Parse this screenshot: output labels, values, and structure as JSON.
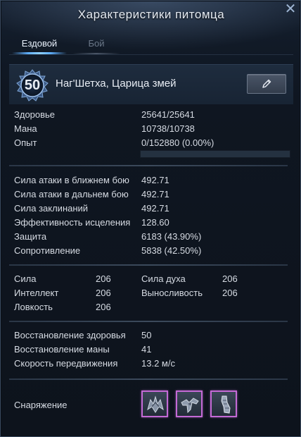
{
  "window": {
    "title": "Характеристики питомца"
  },
  "tabs": [
    {
      "label": "Ездовой",
      "active": true
    },
    {
      "label": "Бой",
      "active": false
    }
  ],
  "pet": {
    "level": "50",
    "name": "Наг'Шетха, Царица змей"
  },
  "basic": {
    "health": {
      "label": "Здоровье",
      "value": "25641/25641"
    },
    "mana": {
      "label": "Мана",
      "value": "10738/10738"
    },
    "exp": {
      "label": "Опыт",
      "value": "0/152880 (0.00%)",
      "progress": 0.0
    }
  },
  "combat": {
    "melee": {
      "label": "Сила атаки в ближнем бою",
      "value": "492.71"
    },
    "ranged": {
      "label": "Сила атаки в дальнем бою",
      "value": "492.71"
    },
    "spell": {
      "label": "Сила заклинаний",
      "value": "492.71"
    },
    "healing": {
      "label": "Эффективность исцеления",
      "value": "128.60"
    },
    "defense": {
      "label": "Защита",
      "value": "6183 (43.90%)"
    },
    "resist": {
      "label": "Сопротивление",
      "value": "5838 (42.50%)"
    }
  },
  "attributes": {
    "strength": {
      "label": "Сила",
      "value": "206"
    },
    "spirit": {
      "label": "Сила духа",
      "value": "206"
    },
    "intellect": {
      "label": "Интеллект",
      "value": "206"
    },
    "stamina": {
      "label": "Выносливость",
      "value": "206"
    },
    "agility": {
      "label": "Ловкость",
      "value": "206"
    }
  },
  "regen": {
    "health": {
      "label": "Восстановление здоровья",
      "value": "50"
    },
    "mana": {
      "label": "Восстановление маны",
      "value": "41"
    },
    "speed": {
      "label": "Скорость передвижения",
      "value": "13.2 м/с"
    }
  },
  "equipment": {
    "label": "Снаряжение",
    "slots": [
      {
        "icon": "helmet-armor-icon",
        "rarity_color": "#c46ad6"
      },
      {
        "icon": "saddle-armor-icon",
        "rarity_color": "#c46ad6"
      },
      {
        "icon": "leg-armor-icon",
        "rarity_color": "#c46ad6"
      }
    ]
  },
  "colors": {
    "accent": "#5fb0ff",
    "epic": "#c46ad6"
  }
}
